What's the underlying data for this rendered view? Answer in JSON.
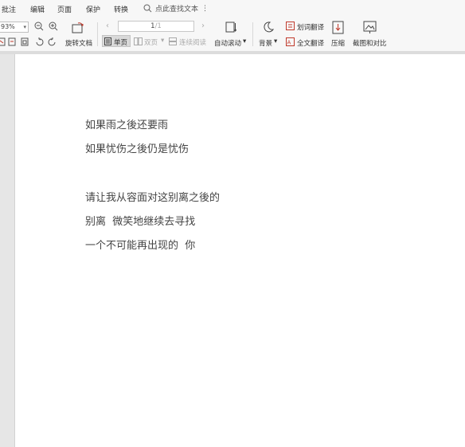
{
  "menu": {
    "items": [
      "批注",
      "编辑",
      "页面",
      "保护",
      "转换"
    ],
    "search_label": "点此查找文本",
    "more": "⋮"
  },
  "toolbar": {
    "zoom_value": "93%",
    "rotate_label": "旋转文档",
    "page_current": "1",
    "page_total": "/1",
    "single_page_label": "单页",
    "double_page_label": "双页",
    "continuous_label": "连续阅读",
    "auto_scroll_label": "自动滚动",
    "background_label": "背景",
    "word_translate_label": "划词翻译",
    "full_translate_label": "全文翻译",
    "compress_label": "压缩",
    "screenshot_compare_label": "截图和对比"
  },
  "document": {
    "lines": [
      "如果雨之後还要雨",
      "如果忧伤之後仍是忧伤",
      "请让我从容面对这别离之後的",
      "别离  微笑地继续去寻找",
      "一个不可能再出现的  你"
    ]
  }
}
